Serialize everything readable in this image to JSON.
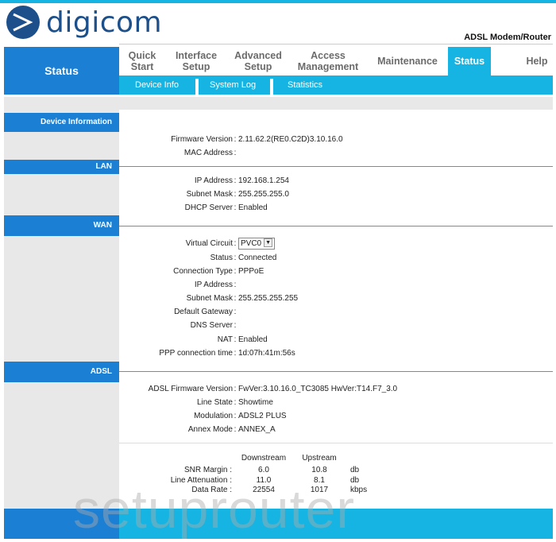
{
  "brand": {
    "name": "digicom",
    "product": "ADSL Modem/Router",
    "logo_icon": "digicom-logo-icon",
    "accent": "#16b4e2",
    "primary": "#1b7fd4",
    "logo_color": "#1d4f8a"
  },
  "header": {
    "section_title": "Status"
  },
  "nav": {
    "items": [
      {
        "label_line1": "Quick",
        "label_line2": "Start"
      },
      {
        "label_line1": "Interface",
        "label_line2": "Setup"
      },
      {
        "label_line1": "Advanced",
        "label_line2": "Setup"
      },
      {
        "label_line1": "Access",
        "label_line2": "Management"
      },
      {
        "label_line1": "Maintenance",
        "label_line2": ""
      },
      {
        "label_line1": "Status",
        "label_line2": "",
        "active": true
      },
      {
        "label_line1": "Help",
        "label_line2": ""
      }
    ],
    "subitems": [
      "Device Info",
      "System Log",
      "Statistics"
    ]
  },
  "sections": {
    "device": {
      "title": "Device Information",
      "rows": [
        {
          "label": "Firmware Version",
          "value": "2.11.62.2(RE0.C2D)3.10.16.0"
        },
        {
          "label": "MAC Address",
          "value": ""
        }
      ]
    },
    "lan": {
      "title": "LAN",
      "rows": [
        {
          "label": "IP Address",
          "value": "192.168.1.254"
        },
        {
          "label": "Subnet Mask",
          "value": "255.255.255.0"
        },
        {
          "label": "DHCP Server",
          "value": "Enabled"
        }
      ]
    },
    "wan": {
      "title": "WAN",
      "virtual_circuit": {
        "label": "Virtual Circuit",
        "selected": "PVC0"
      },
      "rows": [
        {
          "label": "Status",
          "value": "Connected"
        },
        {
          "label": "Connection Type",
          "value": "PPPoE"
        },
        {
          "label": "IP Address",
          "value": ""
        },
        {
          "label": "Subnet Mask",
          "value": "255.255.255.255"
        },
        {
          "label": "Default Gateway",
          "value": ""
        },
        {
          "label": "DNS Server",
          "value": ""
        },
        {
          "label": "NAT",
          "value": "Enabled"
        },
        {
          "label": "PPP connection time",
          "value": "1d:07h:41m:56s"
        }
      ]
    },
    "adsl": {
      "title": "ADSL",
      "rows": [
        {
          "label": "ADSL Firmware Version",
          "value": "FwVer:3.10.16.0_TC3085 HwVer:T14.F7_3.0"
        },
        {
          "label": "Line State",
          "value": "Showtime"
        },
        {
          "label": "Modulation",
          "value": "ADSL2 PLUS"
        },
        {
          "label": "Annex Mode",
          "value": "ANNEX_A"
        }
      ],
      "stats": {
        "col_down": "Downstream",
        "col_up": "Upstream",
        "rows": [
          {
            "label": "SNR Margin :",
            "down": "6.0",
            "up": "10.8",
            "unit": "db"
          },
          {
            "label": "Line Attenuation :",
            "down": "11.0",
            "up": "8.1",
            "unit": "db"
          },
          {
            "label": "Data Rate :",
            "down": "22554",
            "up": "1017",
            "unit": "kbps"
          }
        ]
      }
    }
  },
  "watermark": "setuprouter"
}
